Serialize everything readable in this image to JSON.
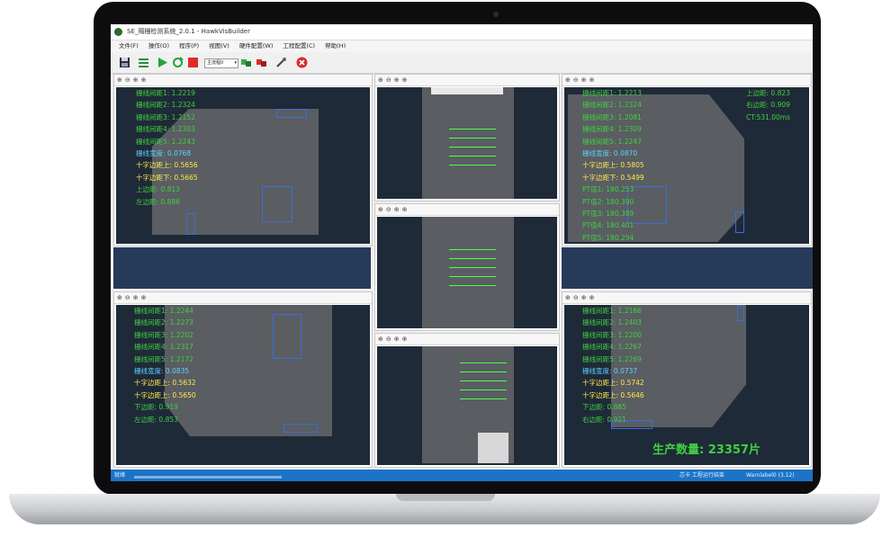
{
  "window": {
    "title": "SE_隔栅检测系统_2.0.1 - HawkVisBuilder"
  },
  "menu": [
    "文件(F)",
    "操作(O)",
    "程序(P)",
    "视图(V)",
    "硬件配置(W)",
    "工程配置(C)",
    "帮助(H)"
  ],
  "toolbar": {
    "combo_value": "主流程0"
  },
  "panels": {
    "top_left": {
      "rows": [
        {
          "text": "栅线间距1: 1.2219",
          "color": "green"
        },
        {
          "text": "栅线间距2: 1.2324",
          "color": "green"
        },
        {
          "text": "栅线间距3: 1.2152",
          "color": "green"
        },
        {
          "text": "栅线间距4: 1.2303",
          "color": "green"
        },
        {
          "text": "栅线间距5: 1.2243",
          "color": "green"
        },
        {
          "text": "栅线宽度: 0.0768",
          "color": "cyan"
        },
        {
          "text": "十字边距上: 0.5656",
          "color": "yellow"
        },
        {
          "text": "十字边距下: 0.5665",
          "color": "yellow"
        },
        {
          "text": "上边距: 0.813",
          "color": "green"
        },
        {
          "text": "左边距: 0.886",
          "color": "green"
        }
      ]
    },
    "top_right": {
      "rows": [
        {
          "text": "栅线间距1: 1.2213",
          "color": "green"
        },
        {
          "text": "栅线间距2: 1.2324",
          "color": "green"
        },
        {
          "text": "栅线间距3: 1.2081",
          "color": "green"
        },
        {
          "text": "栅线间距4: 1.2309",
          "color": "green"
        },
        {
          "text": "栅线间距5: 1.2247",
          "color": "green"
        },
        {
          "text": "栅线宽度: 0.0870",
          "color": "cyan"
        },
        {
          "text": "十字边距上: 0.5805",
          "color": "yellow"
        },
        {
          "text": "十字边距下: 0.5499",
          "color": "yellow"
        },
        {
          "text": "PT值1: 180.253",
          "color": "green"
        },
        {
          "text": "PT值2: 180.390",
          "color": "green"
        },
        {
          "text": "PT值3: 180.389",
          "color": "green"
        },
        {
          "text": "PT值4: 180.401",
          "color": "green"
        },
        {
          "text": "PT值5: 180.294",
          "color": "green"
        }
      ],
      "side": [
        {
          "text": "上边距: 0.823",
          "color": "green"
        },
        {
          "text": "右边距: 0.909",
          "color": "green"
        },
        {
          "text": "CT:531.00ms",
          "color": "green"
        }
      ]
    },
    "bottom_left": {
      "rows": [
        {
          "text": "栅线间距1: 1.2244",
          "color": "green"
        },
        {
          "text": "栅线间距2: 1.2273",
          "color": "green"
        },
        {
          "text": "栅线间距3: 1.2202",
          "color": "green"
        },
        {
          "text": "栅线间距4: 1.2317",
          "color": "green"
        },
        {
          "text": "栅线间距5: 1.2172",
          "color": "green"
        },
        {
          "text": "栅线宽度: 0.0835",
          "color": "cyan"
        },
        {
          "text": "十字边距上: 0.5632",
          "color": "yellow"
        },
        {
          "text": "十字边距上: 0.5650",
          "color": "yellow"
        },
        {
          "text": "下边距: 0.919",
          "color": "green"
        },
        {
          "text": "左边距: 0.853",
          "color": "green"
        }
      ]
    },
    "bottom_right": {
      "rows": [
        {
          "text": "栅线间距1: 1.2166",
          "color": "green"
        },
        {
          "text": "栅线间距2: 1.2403",
          "color": "green"
        },
        {
          "text": "栅线间距3: 1.2200",
          "color": "green"
        },
        {
          "text": "栅线间距4: 1.2267",
          "color": "green"
        },
        {
          "text": "栅线间距5: 1.2269",
          "color": "green"
        },
        {
          "text": "栅线宽度: 0.0737",
          "color": "cyan"
        },
        {
          "text": "十字边距上: 0.5742",
          "color": "yellow"
        },
        {
          "text": "十字边距上: 0.5646",
          "color": "yellow"
        },
        {
          "text": "下边距: 0.885",
          "color": "green"
        },
        {
          "text": "右边距: 0.921",
          "color": "green"
        }
      ],
      "production_count": "生产数量: 23357片"
    }
  },
  "statusbar": {
    "left": "就绪",
    "center": "芯卡 工程运行结束",
    "right": "Warnlabel0 (3.12)"
  },
  "colors": {
    "green": "#3fd13f",
    "cyan": "#5fd0ff",
    "yellow": "#ffe94a",
    "statusbar": "#1c74c8",
    "view_background": "#1f2a38"
  },
  "icons": {
    "zoom_controls": [
      "zoom-in-icon",
      "zoom-out-icon",
      "zoom-fit-icon",
      "zoom-reset-icon"
    ],
    "toolbar": [
      "save-icon",
      "list-icon",
      "play-icon",
      "refresh-icon",
      "stop-icon",
      "combo",
      "plugin-green-icon",
      "plugin-red-icon",
      "tools-icon",
      "close-circle-icon"
    ]
  }
}
